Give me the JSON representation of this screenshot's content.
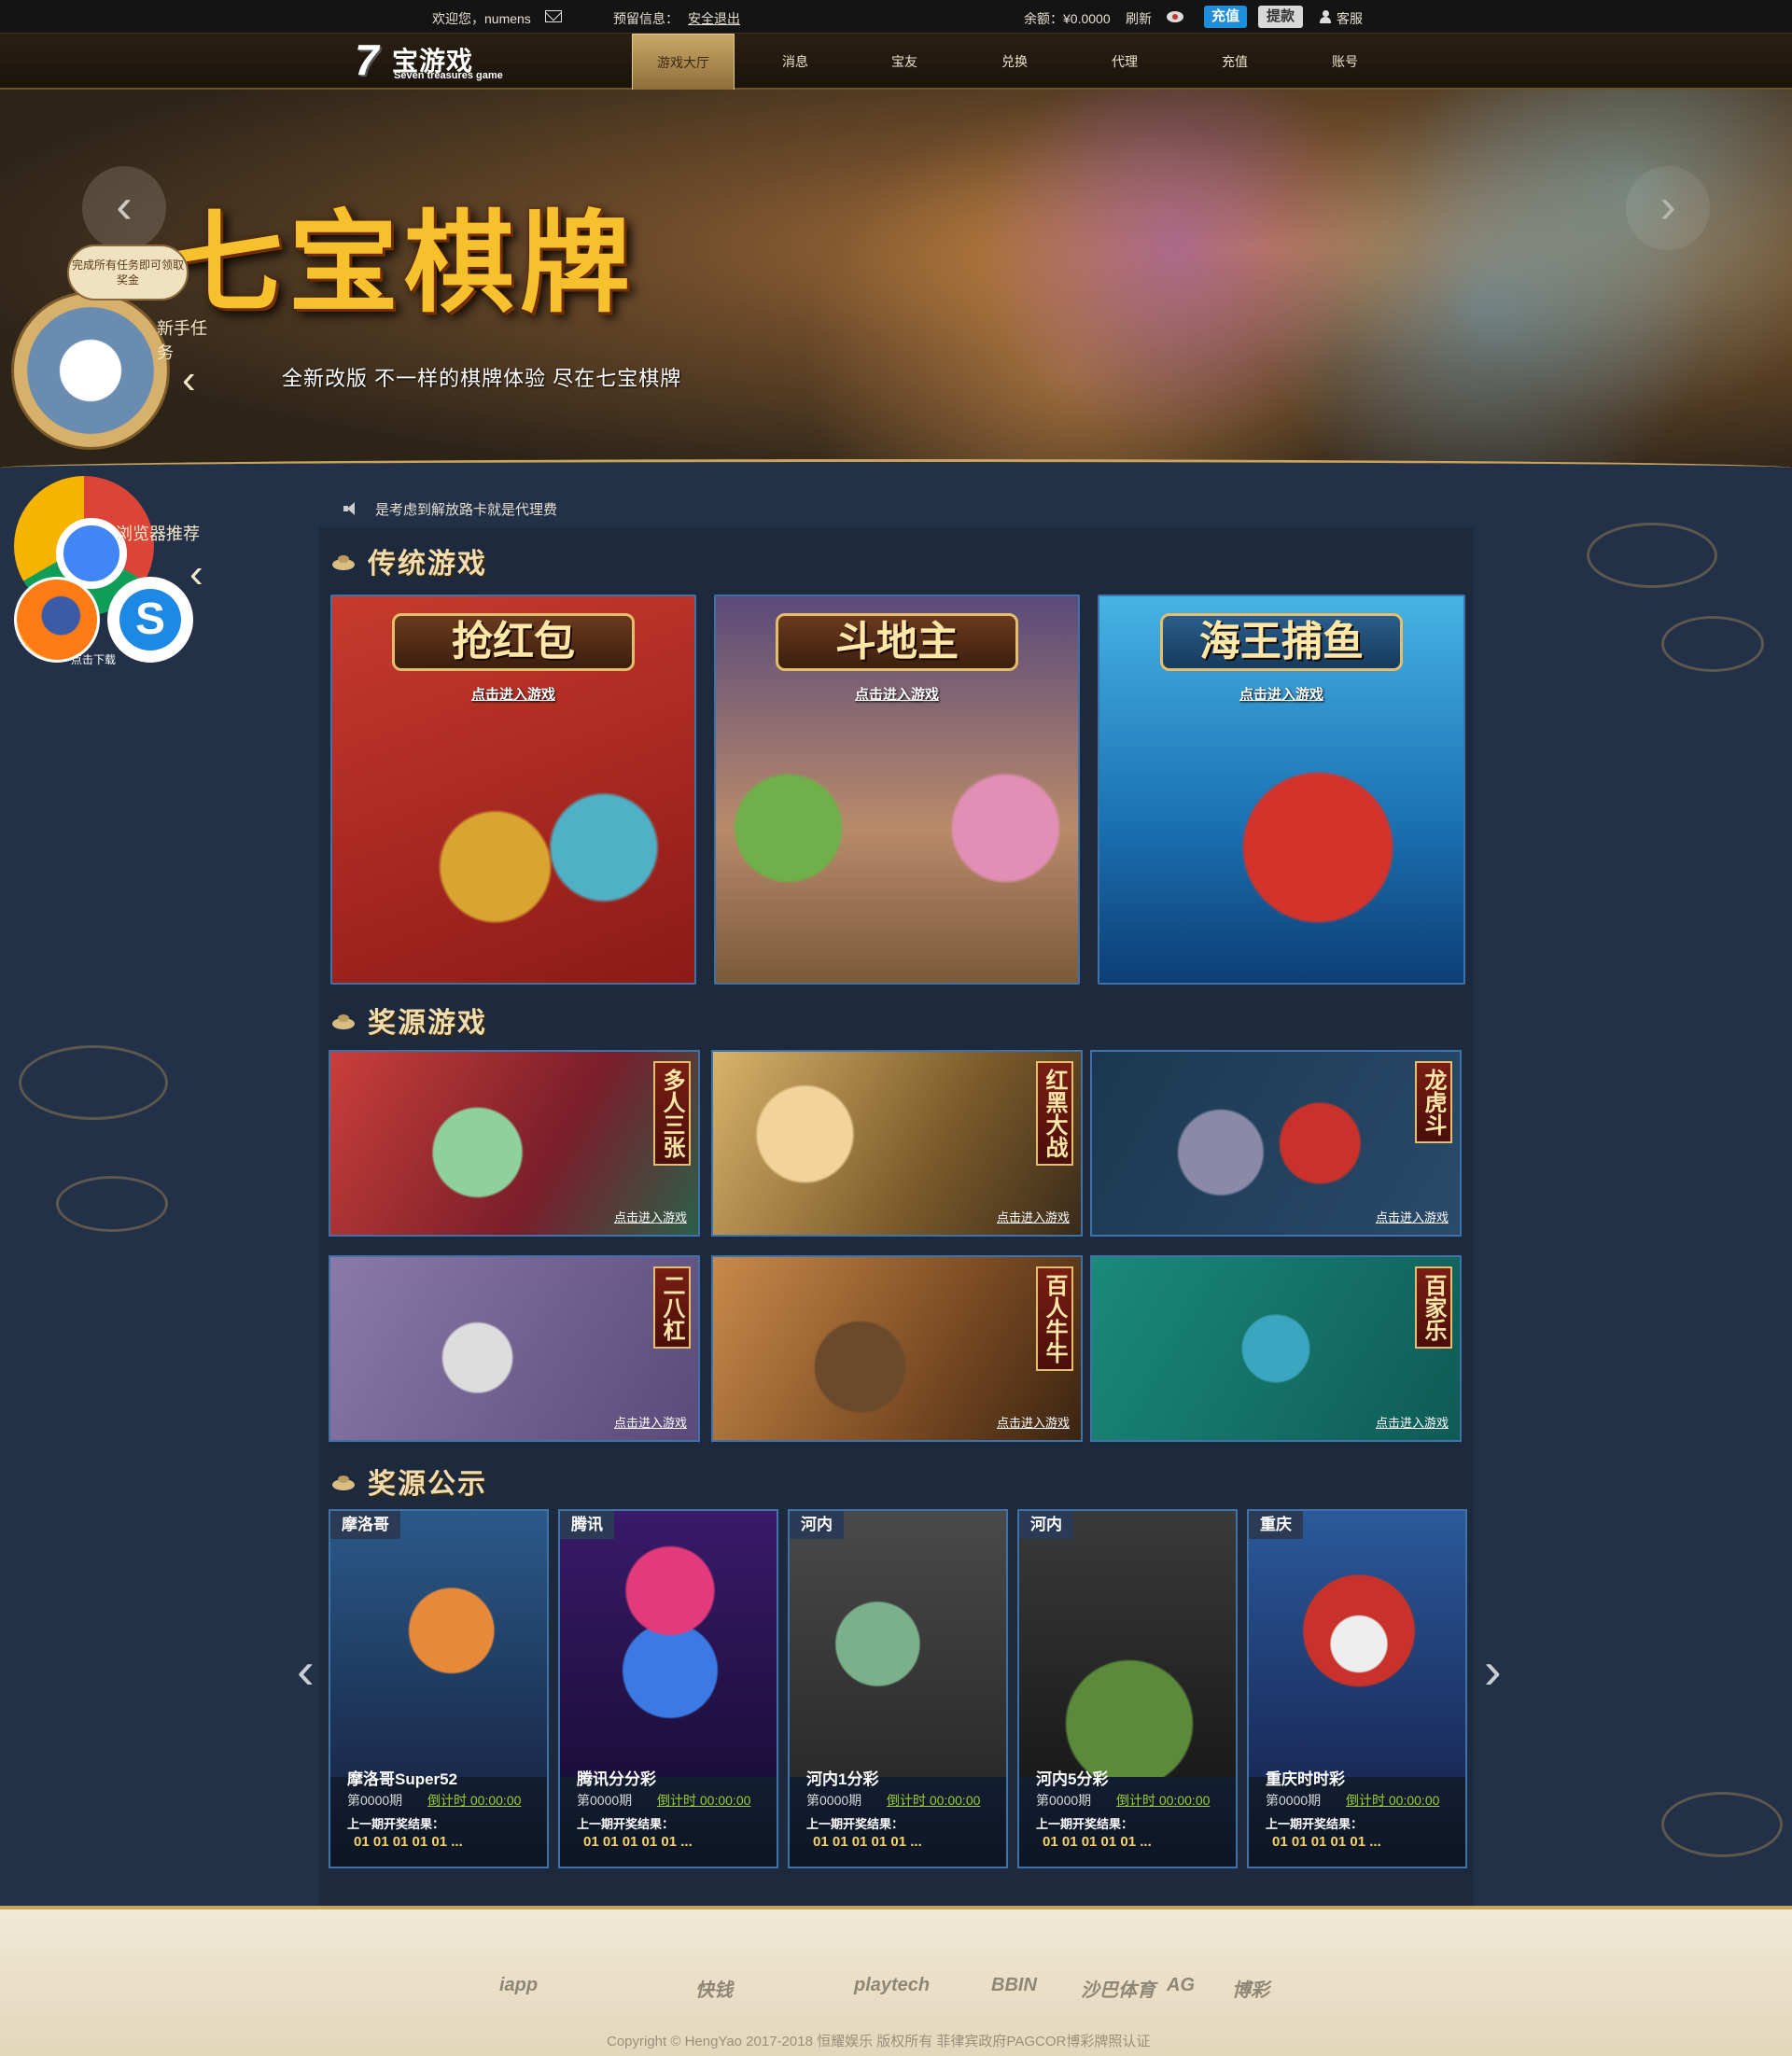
{
  "topbar": {
    "welcome": "欢迎您，numens",
    "reserve_label": "预留信息：",
    "logout": "安全退出",
    "balance": "余额：¥0.0000",
    "refresh": "刷新",
    "recharge_btn": "充值",
    "withdraw_btn": "提款",
    "service": "客服"
  },
  "logo": {
    "cn": "宝游戏",
    "en": "Seven treasures game"
  },
  "nav": [
    {
      "label": "游戏大厅",
      "active": true
    },
    {
      "label": "消息"
    },
    {
      "label": "宝友"
    },
    {
      "label": "兑换"
    },
    {
      "label": "代理"
    },
    {
      "label": "充值"
    },
    {
      "label": "账号"
    }
  ],
  "banner": {
    "title": "七宝棋牌",
    "subtitle": "全新改版  不一样的棋牌体验  尽在七宝棋牌"
  },
  "task_widget": {
    "bubble": "完成所有任务即可领取奖金",
    "label": "新手任务"
  },
  "browser_widget": {
    "label": "浏览器推荐",
    "download": "点击下载"
  },
  "notice": "是考虑到解放路卡就是代理费",
  "sections": {
    "traditional": "传统游戏",
    "reward_games": "奖源游戏",
    "reward_public": "奖源公示"
  },
  "traditional_games": [
    {
      "title": "抢红包",
      "enter": "点击进入游戏"
    },
    {
      "title": "斗地主",
      "enter": "点击进入游戏"
    },
    {
      "title": "海王捕鱼",
      "enter": "点击进入游戏"
    }
  ],
  "reward_games": [
    {
      "title": "多人三张",
      "enter": "点击进入游戏"
    },
    {
      "title": "红黑大战",
      "enter": "点击进入游戏"
    },
    {
      "title": "龙虎斗",
      "enter": "点击进入游戏"
    },
    {
      "title": "二八杠",
      "enter": "点击进入游戏"
    },
    {
      "title": "百人牛牛",
      "enter": "点击进入游戏"
    },
    {
      "title": "百家乐",
      "enter": "点击进入游戏"
    }
  ],
  "lotteries": [
    {
      "tag": "摩洛哥",
      "name": "摩洛哥Super52",
      "period": "第0000期",
      "countdown": "倒计时 00:00:00",
      "last": "上一期开奖结果：",
      "nums": "01 01 01 01 01 ..."
    },
    {
      "tag": "腾讯",
      "name": "腾讯分分彩",
      "period": "第0000期",
      "countdown": "倒计时 00:00:00",
      "last": "上一期开奖结果：",
      "nums": "01 01 01 01 01 ..."
    },
    {
      "tag": "河内",
      "name": "河内1分彩",
      "period": "第0000期",
      "countdown": "倒计时 00:00:00",
      "last": "上一期开奖结果：",
      "nums": "01 01 01 01 01 ..."
    },
    {
      "tag": "河内",
      "name": "河内5分彩",
      "period": "第0000期",
      "countdown": "倒计时 00:00:00",
      "last": "上一期开奖结果：",
      "nums": "01 01 01 01 01 ..."
    },
    {
      "tag": "重庆",
      "name": "重庆时时彩",
      "period": "第0000期",
      "countdown": "倒计时 00:00:00",
      "last": "上一期开奖结果：",
      "nums": "01 01 01 01 01 ..."
    }
  ],
  "footer": {
    "partners": [
      "iapp",
      "快钱",
      "playtech",
      "BBIN",
      "沙巴体育",
      "AG",
      "博彩"
    ],
    "copyright": "Copyright © HengYao 2017-2018 恒耀娱乐 版权所有 菲律宾政府PAGCOR博彩牌照认证"
  }
}
